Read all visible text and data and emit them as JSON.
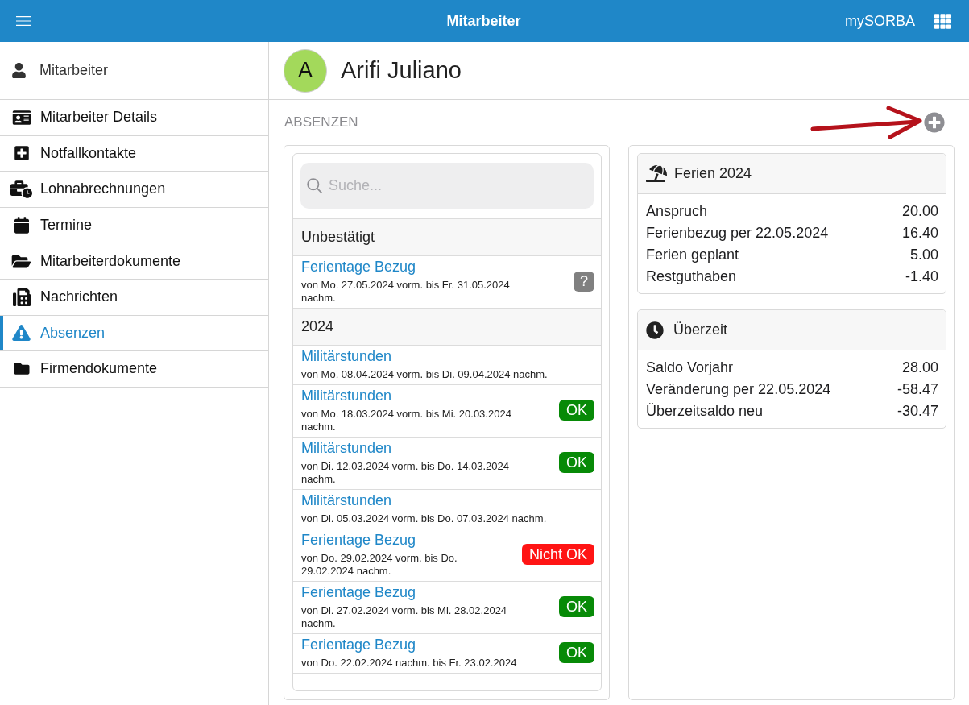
{
  "top_bar": {
    "title": "Mitarbeiter",
    "app_name": "mySORBA"
  },
  "sidebar": {
    "header": "Mitarbeiter",
    "items": [
      {
        "label": "Mitarbeiter Details",
        "selected": false
      },
      {
        "label": "Notfallkontakte",
        "selected": false
      },
      {
        "label": "Lohnabrechnungen",
        "selected": false
      },
      {
        "label": "Termine",
        "selected": false
      },
      {
        "label": "Mitarbeiterdokumente",
        "selected": false
      },
      {
        "label": "Nachrichten",
        "selected": false
      },
      {
        "label": "Absenzen",
        "selected": true
      },
      {
        "label": "Firmendokumente",
        "selected": false
      }
    ]
  },
  "employee": {
    "initial": "A",
    "name": "Arifi Juliano"
  },
  "section_title": "ABSENZEN",
  "absences": {
    "search": {
      "placeholder": "Suche..."
    },
    "groups": [
      {
        "title": "Unbestätigt",
        "items": [
          {
            "type": "Ferientage Bezug",
            "period": "von Mo. 27.05.2024 vorm. bis Fr. 31.05.2024 nachm.",
            "status": {
              "kind": "open",
              "label": "?"
            }
          }
        ]
      },
      {
        "title": "2024",
        "items": [
          {
            "type": "Militärstunden",
            "period": "von Mo. 08.04.2024 vorm. bis Di. 09.04.2024 nachm."
          },
          {
            "type": "Militärstunden",
            "period": "von Mo. 18.03.2024 vorm. bis Mi. 20.03.2024 nachm.",
            "status": {
              "kind": "ok",
              "label": "OK"
            }
          },
          {
            "type": "Militärstunden",
            "period": "von Di. 12.03.2024 vorm. bis Do. 14.03.2024 nachm.",
            "status": {
              "kind": "ok",
              "label": "OK"
            }
          },
          {
            "type": "Militärstunden",
            "period": "von Di. 05.03.2024 vorm. bis Do. 07.03.2024 nachm."
          },
          {
            "type": "Ferientage Bezug",
            "period": "von Do. 29.02.2024 vorm. bis Do. 29.02.2024 nachm.",
            "status": {
              "kind": "rejected",
              "label": "Nicht OK"
            }
          },
          {
            "type": "Ferientage Bezug",
            "period": "von Di. 27.02.2024 vorm. bis Mi. 28.02.2024 nachm.",
            "status": {
              "kind": "ok",
              "label": "OK"
            }
          },
          {
            "type": "Ferientage Bezug",
            "period": "von Do. 22.02.2024 nachm. bis Fr. 23.02.2024",
            "status": {
              "kind": "ok",
              "label": "OK"
            }
          }
        ]
      }
    ]
  },
  "summaries": [
    {
      "title": "Ferien 2024",
      "rows": [
        {
          "label": "Anspruch",
          "value": "20.00"
        },
        {
          "label": "Ferienbezug per 22.05.2024",
          "value": "16.40"
        },
        {
          "label": "Ferien geplant",
          "value": "5.00"
        },
        {
          "label": "Restguthaben",
          "value": "-1.40"
        }
      ]
    },
    {
      "title": "Überzeit",
      "rows": [
        {
          "label": "Saldo Vorjahr",
          "value": "28.00"
        },
        {
          "label": "Veränderung per 22.05.2024",
          "value": "-58.47"
        },
        {
          "label": "Überzeitsaldo neu",
          "value": "-30.47"
        }
      ]
    }
  ]
}
